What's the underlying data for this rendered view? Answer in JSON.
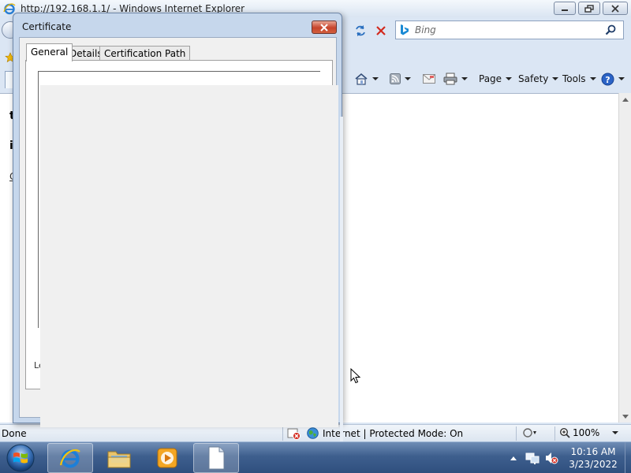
{
  "browser": {
    "title": "http://192.168.1.1/ - Windows Internet Explorer",
    "search_placeholder": "Bing",
    "commands": {
      "page": "Page",
      "safety": "Safety",
      "tools": "Tools"
    },
    "content_fragments": [
      "t",
      "i",
      "C"
    ],
    "status": {
      "text": "Done",
      "zone": "Internet | Protected Mode: On",
      "zoom": "100%"
    }
  },
  "certificate_dialog": {
    "title": "Certificate",
    "tabs": [
      {
        "label": "General",
        "active": true
      },
      {
        "label": "Details",
        "active": false
      },
      {
        "label": "Certification Path",
        "active": false
      }
    ],
    "panel_label_fragment": "Le"
  },
  "taskbar": {
    "clock_time": "10:16 AM",
    "clock_date": "3/23/2022"
  },
  "colors": {
    "accent": "#3e5f8e",
    "close_red": "#c7442c"
  },
  "icons": [
    "ie-logo-icon",
    "bing-icon",
    "home-icon",
    "feeds-icon",
    "mail-icon",
    "print-icon",
    "help-icon",
    "globe-icon",
    "windows-start-icon",
    "folder-icon",
    "media-player-icon",
    "document-icon"
  ]
}
